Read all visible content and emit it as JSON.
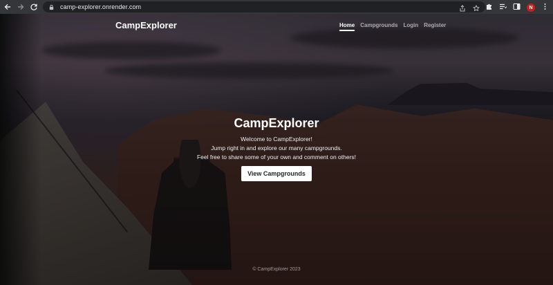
{
  "browser": {
    "url": "camp-explorer.onrender.com",
    "profile_initial": "N",
    "icons": {
      "back": "back-arrow-icon",
      "forward": "forward-arrow-icon",
      "reload": "reload-icon",
      "lock": "lock-icon",
      "share": "share-icon",
      "bookmark": "star-icon",
      "extensions": "puzzle-icon",
      "reading_list": "reading-list-icon",
      "side_panel": "side-panel-icon",
      "menu": "kebab-menu-icon"
    }
  },
  "site": {
    "brand": "CampExplorer",
    "nav": {
      "home": "Home",
      "campgrounds": "Campgrounds",
      "login": "Login",
      "register": "Register"
    },
    "hero": {
      "title": "CampExplorer",
      "line1": "Welcome to CampExplorer!",
      "line2": "Jump right in and explore our many campgrounds.",
      "line3": "Feel free to share some of your own and comment on others!",
      "cta": "View Campgrounds"
    },
    "footer": "© CampExplorer 2023"
  },
  "colors": {
    "chrome_toolbar": "#35363a",
    "omnibox": "#202124",
    "avatar": "#c5221f",
    "cta_bg": "#ffffff",
    "cta_text": "#212529"
  }
}
